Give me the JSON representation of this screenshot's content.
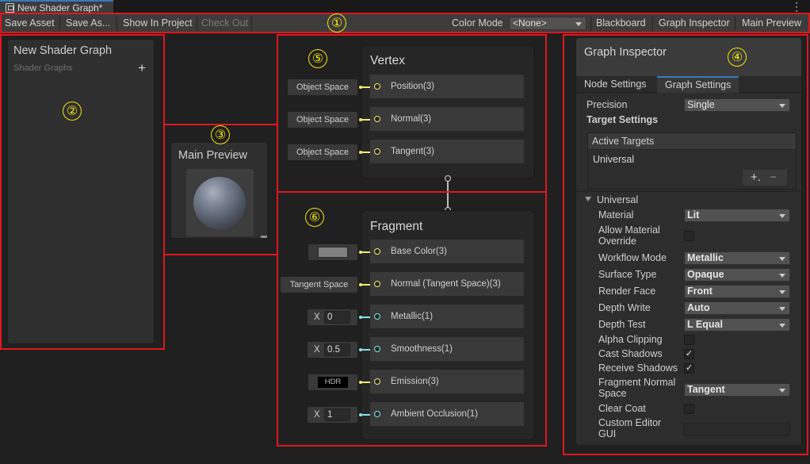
{
  "window": {
    "tab_title": "New Shader Graph*"
  },
  "toolbar": {
    "save_asset": "Save Asset",
    "save_as": "Save As...",
    "show_in_project": "Show In Project",
    "check_out": "Check Out",
    "color_mode_label": "Color Mode",
    "color_mode_value": "<None>",
    "blackboard": "Blackboard",
    "graph_inspector": "Graph Inspector",
    "main_preview": "Main Preview"
  },
  "annotations": {
    "b1": "①",
    "b2": "②",
    "b3": "③",
    "b4": "④",
    "b5": "⑤",
    "b6": "⑥"
  },
  "blackboard": {
    "title": "New Shader Graph",
    "subtitle": "Shader Graphs",
    "add": "+"
  },
  "preview": {
    "title": "Main Preview"
  },
  "vertex": {
    "title": "Vertex",
    "ports": [
      {
        "input": "Object Space",
        "label": "Position(3)"
      },
      {
        "input": "Object Space",
        "label": "Normal(3)"
      },
      {
        "input": "Object Space",
        "label": "Tangent(3)"
      }
    ]
  },
  "fragment": {
    "title": "Fragment",
    "ports": [
      {
        "label": "Base Color(3)",
        "swatch": "#808080"
      },
      {
        "input": "Tangent Space",
        "label": "Normal (Tangent Space)(3)"
      },
      {
        "x": "X",
        "value": "0",
        "label": "Metallic(1)"
      },
      {
        "x": "X",
        "value": "0.5",
        "label": "Smoothness(1)"
      },
      {
        "input": "HDR",
        "label": "Emission(3)"
      },
      {
        "x": "X",
        "value": "1",
        "label": "Ambient Occlusion(1)"
      }
    ]
  },
  "inspector": {
    "title": "Graph Inspector",
    "tabs": [
      "Node Settings",
      "Graph Settings"
    ],
    "precision_label": "Precision",
    "precision_value": "Single",
    "target_settings": "Target Settings",
    "active_targets": "Active Targets",
    "target_item": "Universal",
    "add": "+.",
    "remove": "−",
    "universal_section": "Universal",
    "rows": [
      {
        "label": "Material",
        "value": "Lit"
      },
      {
        "label": "Allow Material Override",
        "checked": ""
      },
      {
        "label": "Workflow Mode",
        "value": "Metallic"
      },
      {
        "label": "Surface Type",
        "value": "Opaque"
      },
      {
        "label": "Render Face",
        "value": "Front"
      },
      {
        "label": "Depth Write",
        "value": "Auto"
      },
      {
        "label": "Depth Test",
        "value": "L Equal"
      },
      {
        "label": "Alpha Clipping",
        "checked": ""
      },
      {
        "label": "Cast Shadows",
        "checked": "✓"
      },
      {
        "label": "Receive Shadows",
        "checked": "✓"
      },
      {
        "label": "Fragment Normal Space",
        "value": "Tangent"
      },
      {
        "label": "Clear Coat",
        "checked": ""
      },
      {
        "label": "Custom Editor GUI",
        "text": ""
      }
    ]
  },
  "colors": {
    "annotation_red": "#e0171e",
    "annotation_yellow": "#f5e60e",
    "accent_blue": "#3a79bb",
    "port_yellow": "#ebeb73",
    "port_cyan": "#84e4e7"
  }
}
